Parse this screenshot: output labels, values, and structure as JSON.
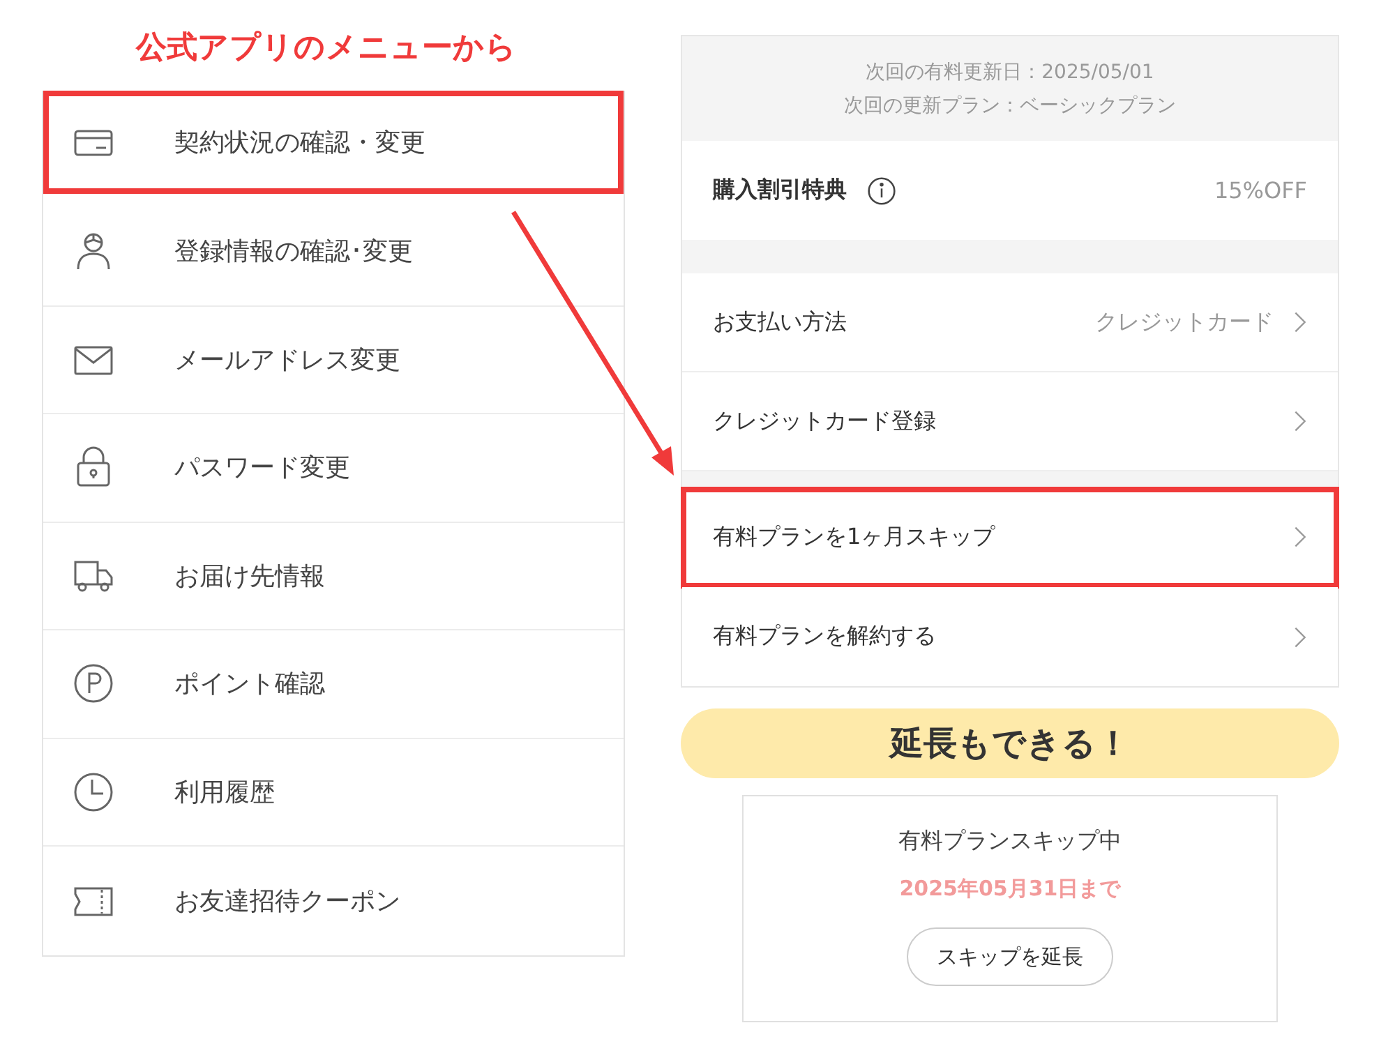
{
  "heading": "公式アプリのメニューから",
  "menu": [
    {
      "kind": "card",
      "label": "契約状況の確認・変更",
      "highlighted": true
    },
    {
      "kind": "person",
      "label": "登録情報の確認･変更",
      "highlighted": false
    },
    {
      "kind": "mail",
      "label": "メールアドレス変更",
      "highlighted": false
    },
    {
      "kind": "lock",
      "label": "パスワード変更",
      "highlighted": false
    },
    {
      "kind": "truck",
      "label": "お届け先情報",
      "highlighted": false
    },
    {
      "kind": "points",
      "label": "ポイント確認",
      "highlighted": false
    },
    {
      "kind": "clock",
      "label": "利用履歴",
      "highlighted": false
    },
    {
      "kind": "ticket",
      "label": "お友達招待クーポン",
      "highlighted": false
    }
  ],
  "plan_info": [
    "次回の有料更新日：2025/05/01",
    "次回の更新プラン：ベーシックプラン"
  ],
  "discount": {
    "label": "購入割引特典",
    "value": "15%OFF"
  },
  "sections": [
    {
      "rows": [
        {
          "label": "お支払い方法",
          "value": "クレジットカード",
          "highlighted": false
        },
        {
          "label": "クレジットカード登録",
          "highlighted": false
        }
      ]
    },
    {
      "rows": [
        {
          "label": "有料プランを1ヶ月スキップ",
          "highlighted": true
        },
        {
          "label": "有料プランを解約する",
          "highlighted": false
        }
      ]
    }
  ],
  "callout": "延長もできる！",
  "skip_status": {
    "title": "有料プランスキップ中",
    "until": "2025年05月31日まで",
    "button": "スキップを延長"
  }
}
